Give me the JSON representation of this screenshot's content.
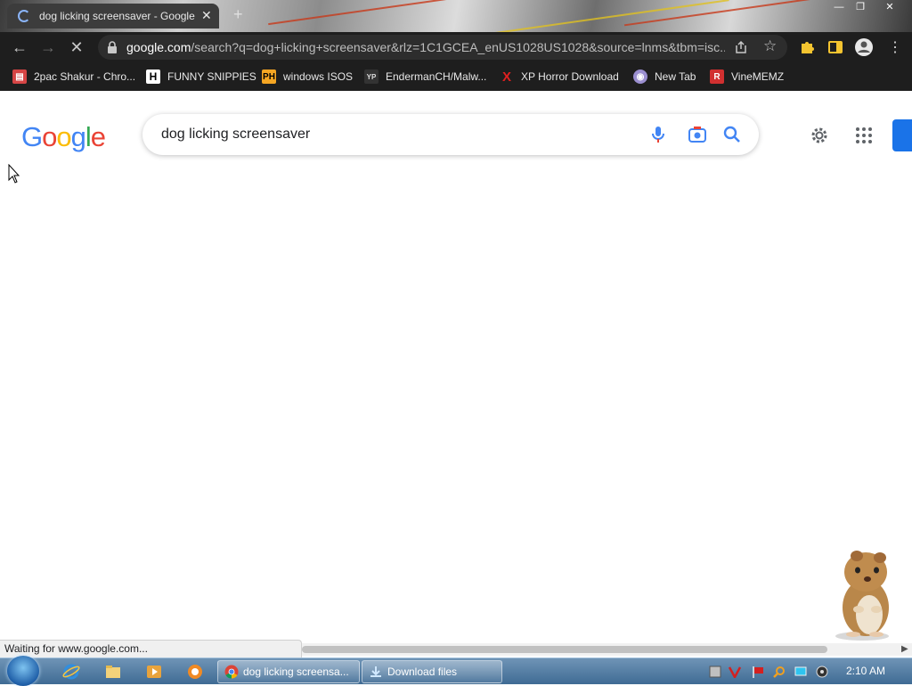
{
  "browser": {
    "tab": {
      "title": "dog licking screensaver - Google"
    },
    "url": {
      "host": "google.com",
      "path": "/search?q=dog+licking+screensaver&rlz=1C1GCEA_enUS1028US1028&source=lnms&tbm=isc..."
    },
    "bookmarks": [
      {
        "label": "2pac Shakur - Chro...",
        "icon": "page-icon",
        "color": "#d64545"
      },
      {
        "label": "FUNNY SNIPPIES",
        "icon": "H",
        "color": "#ffffff"
      },
      {
        "label": "windows ISOS",
        "icon": "PH",
        "color": "#f5a623"
      },
      {
        "label": "EndermanCH/Malw...",
        "icon": "YP",
        "color": "#333333"
      },
      {
        "label": "XP Horror Download",
        "icon": "X",
        "color": "#e02020"
      },
      {
        "label": "New Tab",
        "icon": "globe-icon",
        "color": "#9b8fd0"
      },
      {
        "label": "VineMEMZ",
        "icon": "R",
        "color": "#d13030"
      }
    ],
    "status": "Waiting for www.google.com..."
  },
  "google": {
    "logo_letters": [
      "G",
      "o",
      "o",
      "g",
      "l",
      "e"
    ],
    "logo_colors": [
      "#4285F4",
      "#EA4335",
      "#FBBC05",
      "#4285F4",
      "#34A853",
      "#EA4335"
    ],
    "query": "dog licking screensaver"
  },
  "taskbar": {
    "windows": [
      {
        "label": "dog licking screensa..."
      },
      {
        "label": "Download files"
      }
    ],
    "clock": "2:10 AM"
  }
}
